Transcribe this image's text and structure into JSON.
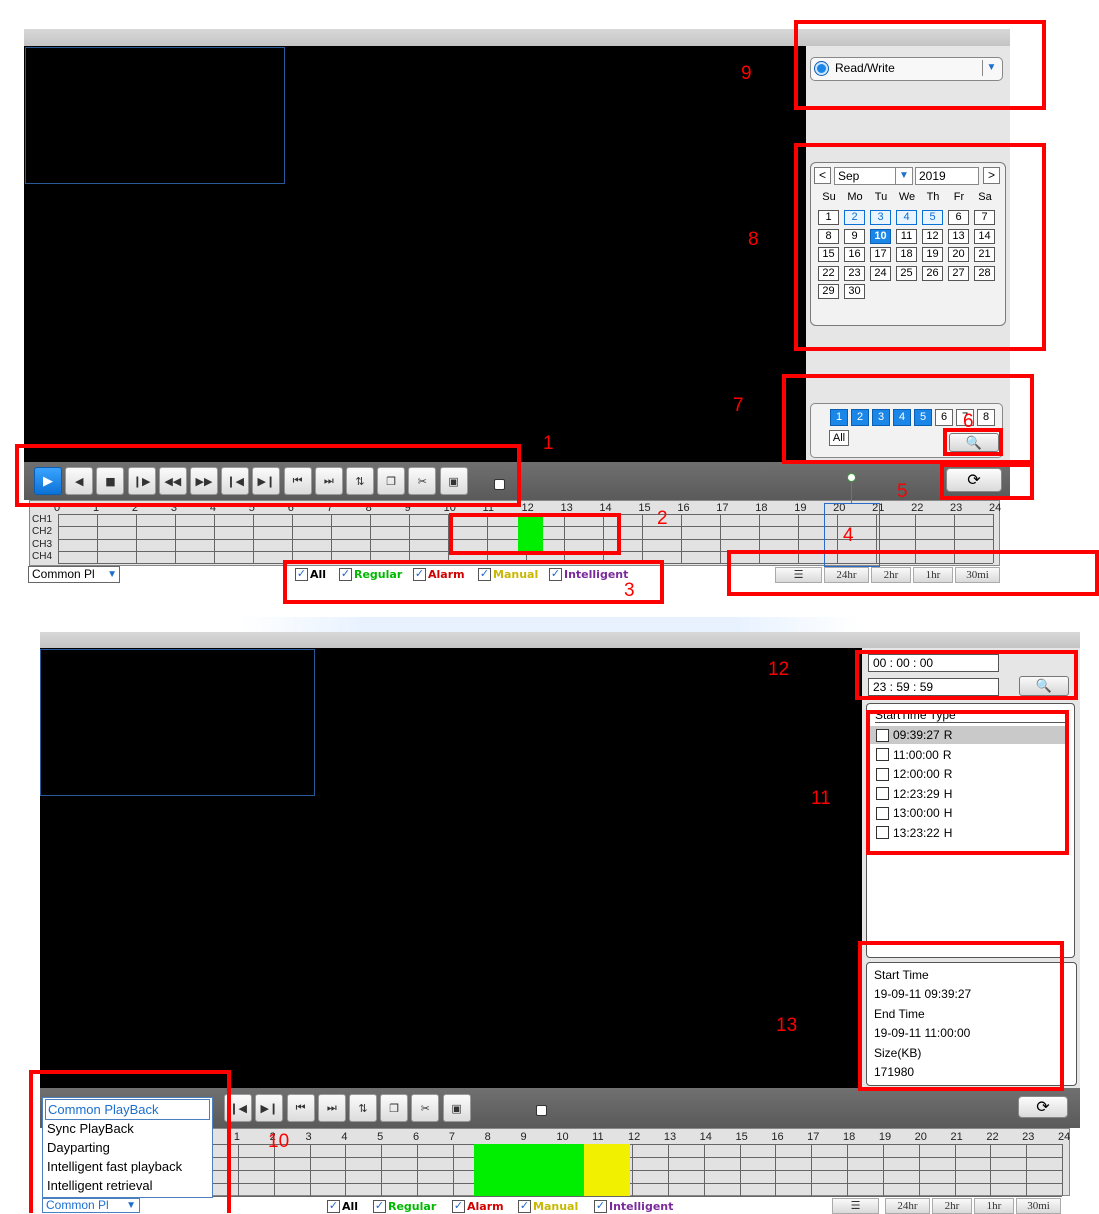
{
  "annotations": {
    "n1": "1",
    "n2": "2",
    "n3": "3",
    "n4": "4",
    "n5": "5",
    "n6": "6",
    "n7": "7",
    "n8": "8",
    "n9": "9",
    "n10": "10",
    "n11": "11",
    "n12": "12",
    "n13": "13"
  },
  "panel_top": {
    "access_mode": "Read/Write",
    "calendar": {
      "month": "Sep",
      "year": "2019",
      "prev": "<",
      "next": ">",
      "weekdays": [
        "Su",
        "Mo",
        "Tu",
        "We",
        "Th",
        "Fr",
        "Sa"
      ],
      "days": [
        "1",
        "2",
        "3",
        "4",
        "5",
        "6",
        "7",
        "8",
        "9",
        "10",
        "11",
        "12",
        "13",
        "14",
        "15",
        "16",
        "17",
        "18",
        "19",
        "20",
        "21",
        "22",
        "23",
        "24",
        "25",
        "26",
        "27",
        "28",
        "29",
        "30"
      ],
      "recorded_days": [
        "2",
        "3",
        "4",
        "5"
      ],
      "selected_day": "10"
    },
    "channels": [
      "1",
      "2",
      "3",
      "4",
      "5",
      "6",
      "7",
      "8"
    ],
    "channels_selected": [
      "1",
      "2",
      "3",
      "4",
      "5"
    ],
    "all_label": "All"
  },
  "timeline": {
    "hours": [
      "0",
      "1",
      "2",
      "3",
      "4",
      "5",
      "6",
      "7",
      "8",
      "9",
      "10",
      "11",
      "12",
      "13",
      "14",
      "15",
      "16",
      "17",
      "18",
      "19",
      "20",
      "21",
      "22",
      "23",
      "24"
    ],
    "channels": [
      "CH1",
      "CH2",
      "CH3",
      "CH4"
    ]
  },
  "mode_select": "Common Pl",
  "filters": {
    "all": "All",
    "regular": "Regular",
    "alarm": "Alarm",
    "manual": "Manual",
    "intelligent": "Intelligent"
  },
  "scales": [
    "24hr",
    "2hr",
    "1hr",
    "30mi"
  ],
  "scales_bottom": [
    "24hr",
    "2hr",
    "1hr",
    "30mi"
  ],
  "panel_bottom": {
    "start_time": "00 : 00 : 00",
    "end_time": "23 : 59 : 59",
    "list_header": "StartTime Type",
    "files": [
      {
        "time": "09:39:27",
        "type": "R"
      },
      {
        "time": "11:00:00",
        "type": "R"
      },
      {
        "time": "12:00:00",
        "type": "R"
      },
      {
        "time": "12:23:29",
        "type": "H"
      },
      {
        "time": "13:00:00",
        "type": "H"
      },
      {
        "time": "13:23:22",
        "type": "H"
      }
    ],
    "info": {
      "start_label": "Start Time",
      "start_value": "19-09-11 09:39:27",
      "end_label": "End Time",
      "end_value": "19-09-11 11:00:00",
      "size_label": "Size(KB)",
      "size_value": "171980"
    }
  },
  "playback_modes": [
    "Common PlayBack",
    "Sync PlayBack",
    "Dayparting",
    "Intelligent fast playback",
    "Intelligent retrieval"
  ],
  "colors": {
    "regular": "#00ee00",
    "alarm": "#d00000",
    "manual": "#f0f000",
    "intelligent": "#7a2a9a",
    "accent": "#1a86e8",
    "annotation": "#ff0000"
  }
}
